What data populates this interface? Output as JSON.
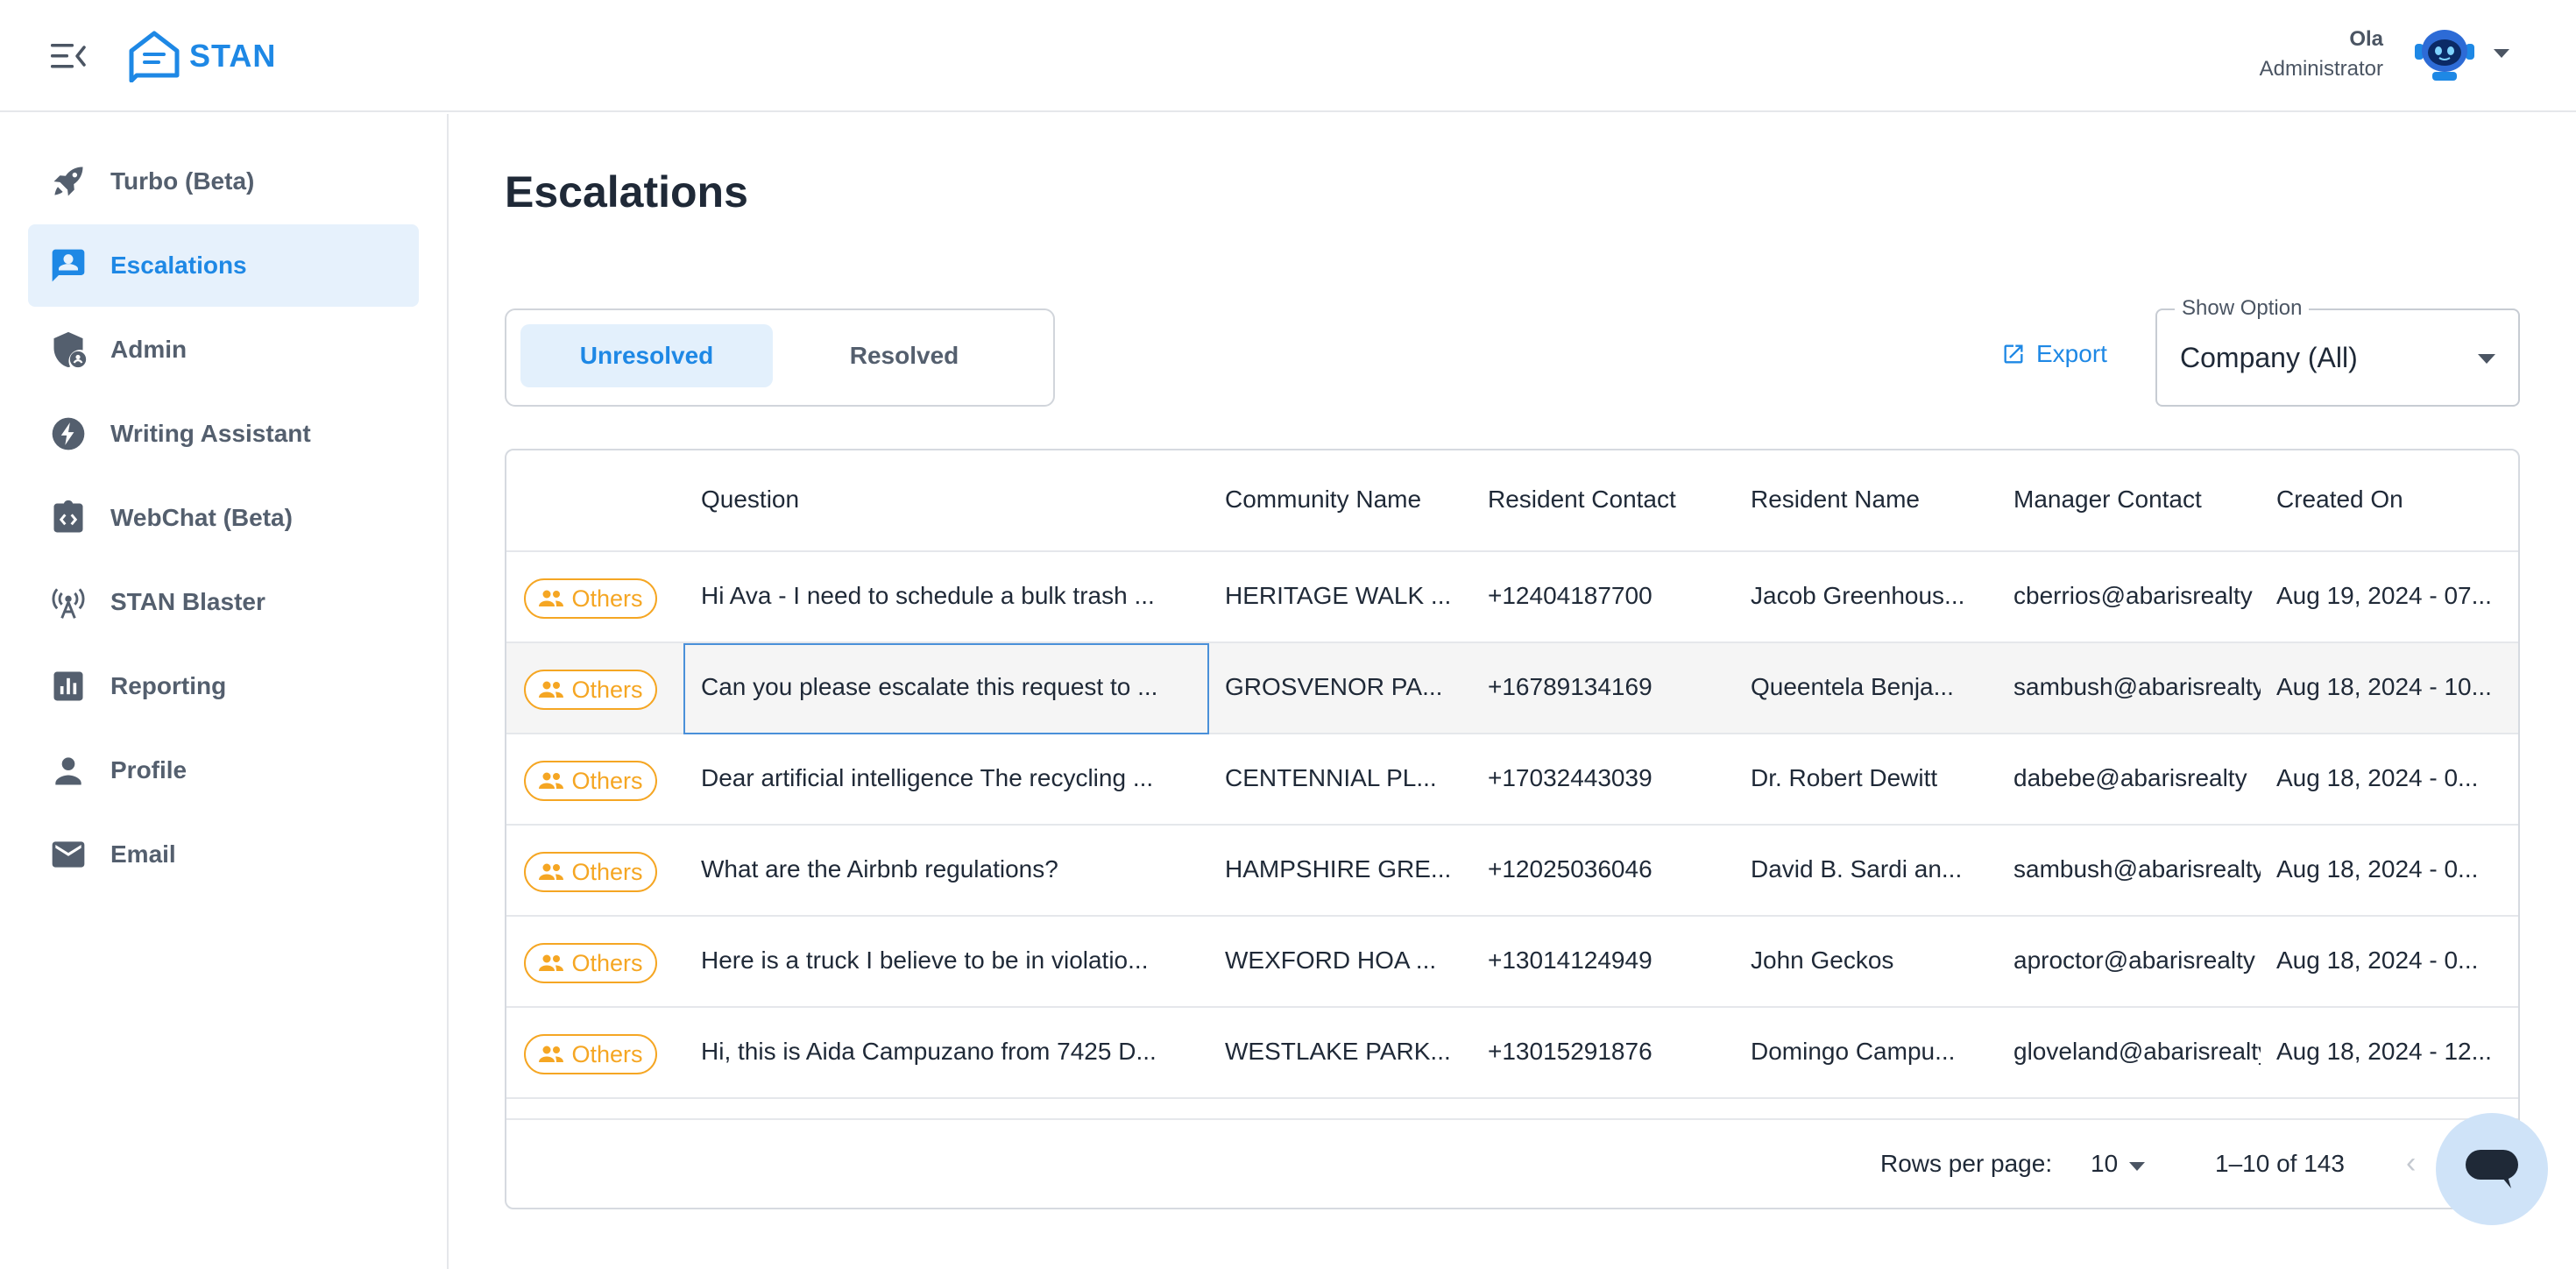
{
  "app": {
    "name": "STAN"
  },
  "header": {
    "menu_icon": "menu-collapse-icon",
    "user_name": "Ola",
    "user_role": "Administrator"
  },
  "sidebar": {
    "items": [
      {
        "label": "Turbo (Beta)",
        "icon": "rocket-icon"
      },
      {
        "label": "Escalations",
        "icon": "contact-card-icon",
        "active": true
      },
      {
        "label": "Admin",
        "icon": "admin-shield-icon"
      },
      {
        "label": "Writing Assistant",
        "icon": "lightning-icon"
      },
      {
        "label": "WebChat (Beta)",
        "icon": "code-clipboard-icon"
      },
      {
        "label": "STAN Blaster",
        "icon": "broadcast-tower-icon"
      },
      {
        "label": "Reporting",
        "icon": "bar-chart-icon"
      },
      {
        "label": "Profile",
        "icon": "person-icon"
      },
      {
        "label": "Email",
        "icon": "mail-icon"
      }
    ]
  },
  "main": {
    "title": "Escalations",
    "tabs": [
      {
        "label": "Unresolved",
        "active": true
      },
      {
        "label": "Resolved",
        "active": false
      }
    ],
    "export_label": "Export",
    "show_option": {
      "legend": "Show Option",
      "value": "Company (All)"
    }
  },
  "table": {
    "columns": [
      "Question",
      "Community Name",
      "Resident Contact",
      "Resident Name",
      "Manager Contact",
      "Created On"
    ],
    "rows": [
      {
        "category": "Others",
        "question": "Hi Ava - I need to schedule a bulk trash ...",
        "community": "HERITAGE WALK ...",
        "resident_contact": "+12404187700",
        "resident_name": "Jacob Greenhous...",
        "manager_contact": "cberrios@abarisrealty",
        "created_on": "Aug 19, 2024 - 07..."
      },
      {
        "category": "Others",
        "question": "Can you please escalate this request to ...",
        "community": "GROSVENOR PA...",
        "resident_contact": "+16789134169",
        "resident_name": "Queentela Benja...",
        "manager_contact": "sambush@abarisrealty",
        "created_on": "Aug 18, 2024 - 10..."
      },
      {
        "category": "Others",
        "question": "Dear artificial intelligence The recycling ...",
        "community": "CENTENNIAL PL...",
        "resident_contact": "+17032443039",
        "resident_name": "Dr. Robert Dewitt",
        "manager_contact": "dabebe@abarisrealty",
        "created_on": "Aug 18, 2024 - 0..."
      },
      {
        "category": "Others",
        "question": "What are the Airbnb regulations?",
        "community": "HAMPSHIRE GRE...",
        "resident_contact": "+12025036046",
        "resident_name": "David B. Sardi an...",
        "manager_contact": "sambush@abarisrealty",
        "created_on": "Aug 18, 2024 - 0..."
      },
      {
        "category": "Others",
        "question": "Here is a truck I believe to be in violatio...",
        "community": "WEXFORD HOA ...",
        "resident_contact": "+13014124949",
        "resident_name": "John Geckos",
        "manager_contact": "aproctor@abarisrealty",
        "created_on": "Aug 18, 2024 - 0..."
      },
      {
        "category": "Others",
        "question": "Hi, this is Aida Campuzano from 7425 D...",
        "community": "WESTLAKE PARK...",
        "resident_contact": "+13015291876",
        "resident_name": "Domingo Campu...",
        "manager_contact": "gloveland@abarisrealty",
        "created_on": "Aug 18, 2024 - 12..."
      }
    ],
    "footer": {
      "rows_per_page_label": "Rows per page:",
      "rows_per_page_value": "10",
      "range": "1–10 of 143"
    }
  },
  "colors": {
    "accent": "#1e88e5",
    "active_bg": "#e6f1fc",
    "badge": "#f5a623",
    "text": "#1f2937",
    "muted": "#545f6e"
  }
}
